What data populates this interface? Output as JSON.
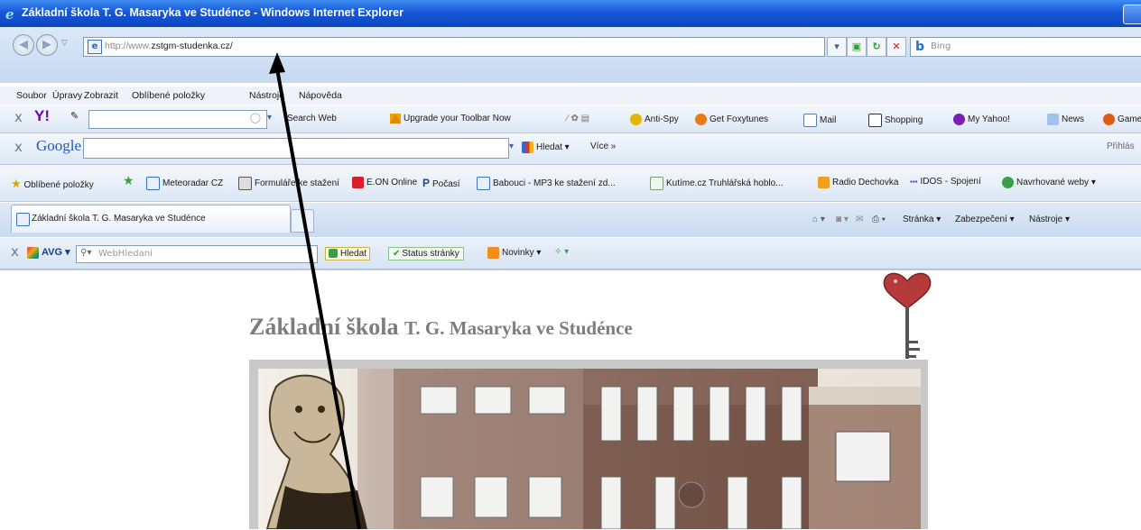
{
  "window": {
    "title": "Základní škola T. G. Masaryka ve Studénce - Windows Internet Explorer"
  },
  "address_bar": {
    "url_prefix": "http://www.",
    "url_main": "zstgm-studenka.cz/",
    "search_placeholder": "Bing"
  },
  "menu": [
    "Soubor",
    "Úpravy",
    "Zobrazit",
    "Oblíbené položky",
    "Nástroje",
    "Nápověda"
  ],
  "yahoo_toolbar": {
    "search_web": "Search Web",
    "upgrade": "Upgrade your Toolbar Now",
    "antispy": "Anti-Spy",
    "foxytunes": "Get Foxytunes",
    "mail": "Mail",
    "shopping": "Shopping",
    "my_yahoo": "My Yahoo!",
    "news": "News",
    "games": "Games"
  },
  "google_toolbar": {
    "logo": "Google",
    "search": "Hledat",
    "more": "Více »",
    "signin": "Přihlás"
  },
  "favorites_bar": {
    "label": "Oblíbené položky",
    "items": [
      "Meteoradar CZ",
      "Formuláře ke stažení",
      "E.ON Online",
      "Počasí",
      "Babouci - MP3 ke stažení zd...",
      "Kutíme.cz Truhlářská hoblo...",
      "Radio Dechovka",
      "IDOS - Spojení",
      "Navrhované weby"
    ]
  },
  "tab": {
    "label": "Základní škola T. G. Masaryka ve Studénce"
  },
  "command_bar": {
    "page": "Stránka",
    "security": "Zabezpečení",
    "tools": "Nástroje"
  },
  "avg_toolbar": {
    "logo": "AVG",
    "search_placeholder": "WebHledani",
    "search": "Hledat",
    "status": "Status stránky",
    "news": "Novinky"
  },
  "page": {
    "heading_big1": "Základní škola ",
    "heading_small": "T. G. Masaryka ve Studénce"
  },
  "colors": {
    "titlebar": "#1657d6",
    "heading": "#7d7d7d",
    "arrow": "#000000"
  }
}
